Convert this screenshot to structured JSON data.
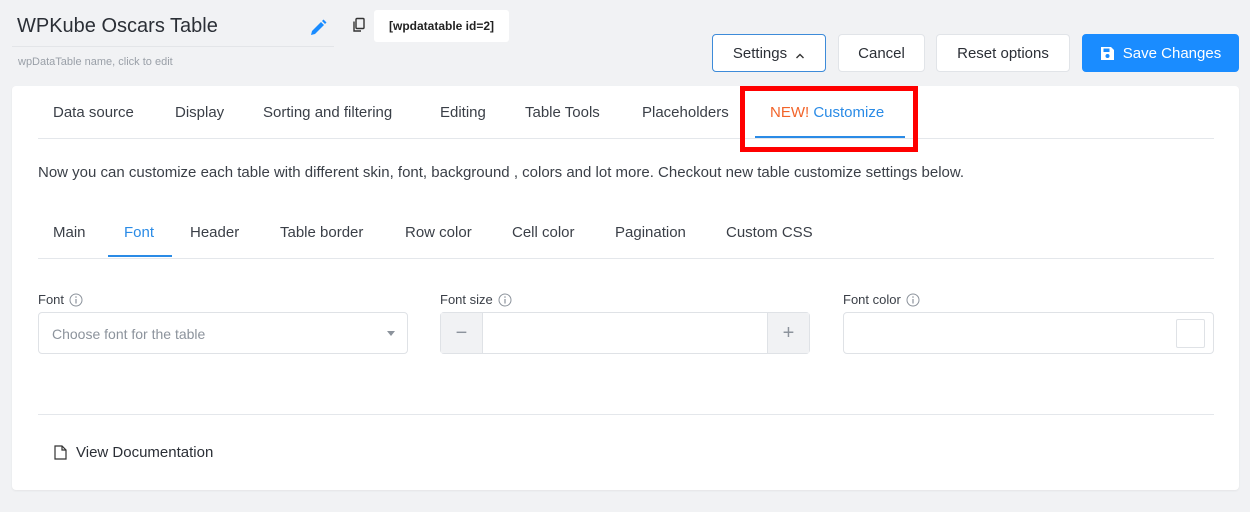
{
  "header": {
    "table_name": "WPKube Oscars Table",
    "name_hint": "wpDataTable name, click to edit",
    "shortcode": "[wpdatatable id=2]"
  },
  "toolbar": {
    "settings_label": "Settings",
    "cancel_label": "Cancel",
    "reset_label": "Reset options",
    "save_label": "Save Changes"
  },
  "tabs": [
    {
      "label": "Data source"
    },
    {
      "label": "Display"
    },
    {
      "label": "Sorting and filtering"
    },
    {
      "label": "Editing"
    },
    {
      "label": "Table Tools"
    },
    {
      "label": "Placeholders"
    },
    {
      "new_badge": "NEW!",
      "label": "Customize",
      "active": true
    }
  ],
  "info_text": "Now you can customize each table with different skin, font, background , colors and lot more. Checkout new table customize settings below.",
  "subtabs": [
    {
      "label": "Main"
    },
    {
      "label": "Font",
      "active": true
    },
    {
      "label": "Header"
    },
    {
      "label": "Table border"
    },
    {
      "label": "Row color"
    },
    {
      "label": "Cell color"
    },
    {
      "label": "Pagination"
    },
    {
      "label": "Custom CSS"
    }
  ],
  "fields": {
    "font": {
      "label": "Font",
      "placeholder": "Choose font for the table"
    },
    "font_size": {
      "label": "Font size",
      "value": ""
    },
    "font_color": {
      "label": "Font color",
      "value": ""
    }
  },
  "doc_link_label": "View Documentation",
  "colors": {
    "accent": "#2a8be6",
    "save_button": "#1a8cff",
    "new_badge": "#f2642a",
    "highlight": "#ff0000"
  }
}
